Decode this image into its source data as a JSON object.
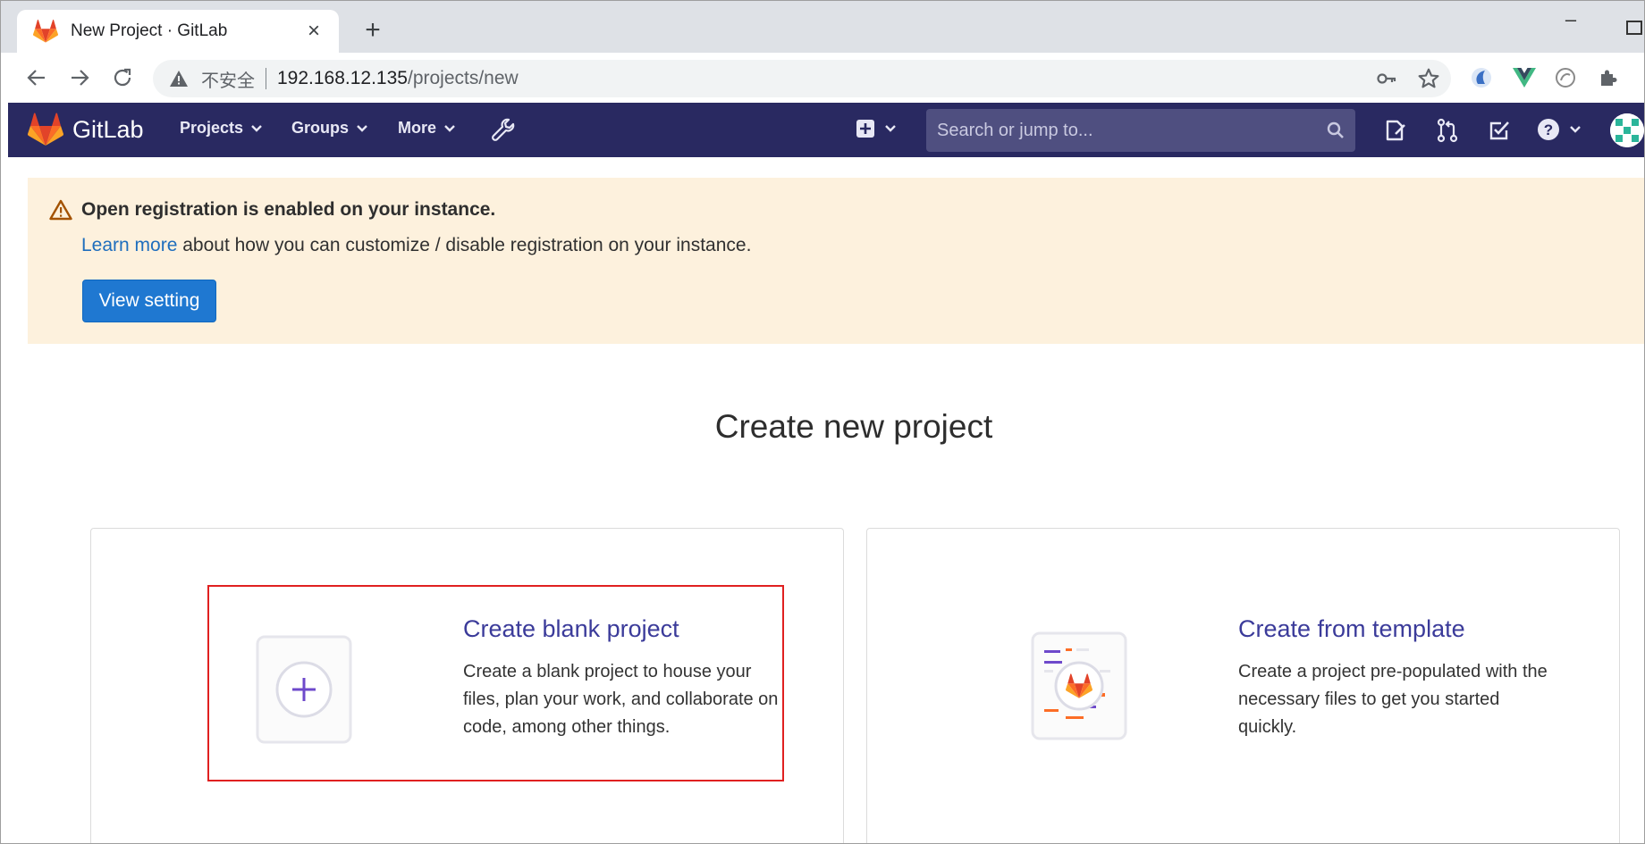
{
  "browser": {
    "tab_title": "New Project · GitLab",
    "security_label": "不安全",
    "url_host": "192.168.12.135",
    "url_path": "/projects/new"
  },
  "gitlab_header": {
    "brand": "GitLab",
    "menu": [
      "Projects",
      "Groups",
      "More"
    ],
    "search_placeholder": "Search or jump to..."
  },
  "banner": {
    "title": "Open registration is enabled on your instance.",
    "link_text": "Learn more",
    "text": " about how you can customize / disable registration on your instance.",
    "button_label": "View setting"
  },
  "main": {
    "title": "Create new project",
    "cards": [
      {
        "title": "Create blank project",
        "description": "Create a blank project to house your files, plan your work, and collaborate on code, among other things."
      },
      {
        "title": "Create from template",
        "description": "Create a project pre-populated with the necessary files to get you started quickly."
      }
    ]
  },
  "colors": {
    "header_bg": "#292961",
    "banner_bg": "#fdf1dd",
    "primary_button": "#1f78d1",
    "card_title": "#3b3b9a",
    "highlight_border": "#e02020"
  }
}
